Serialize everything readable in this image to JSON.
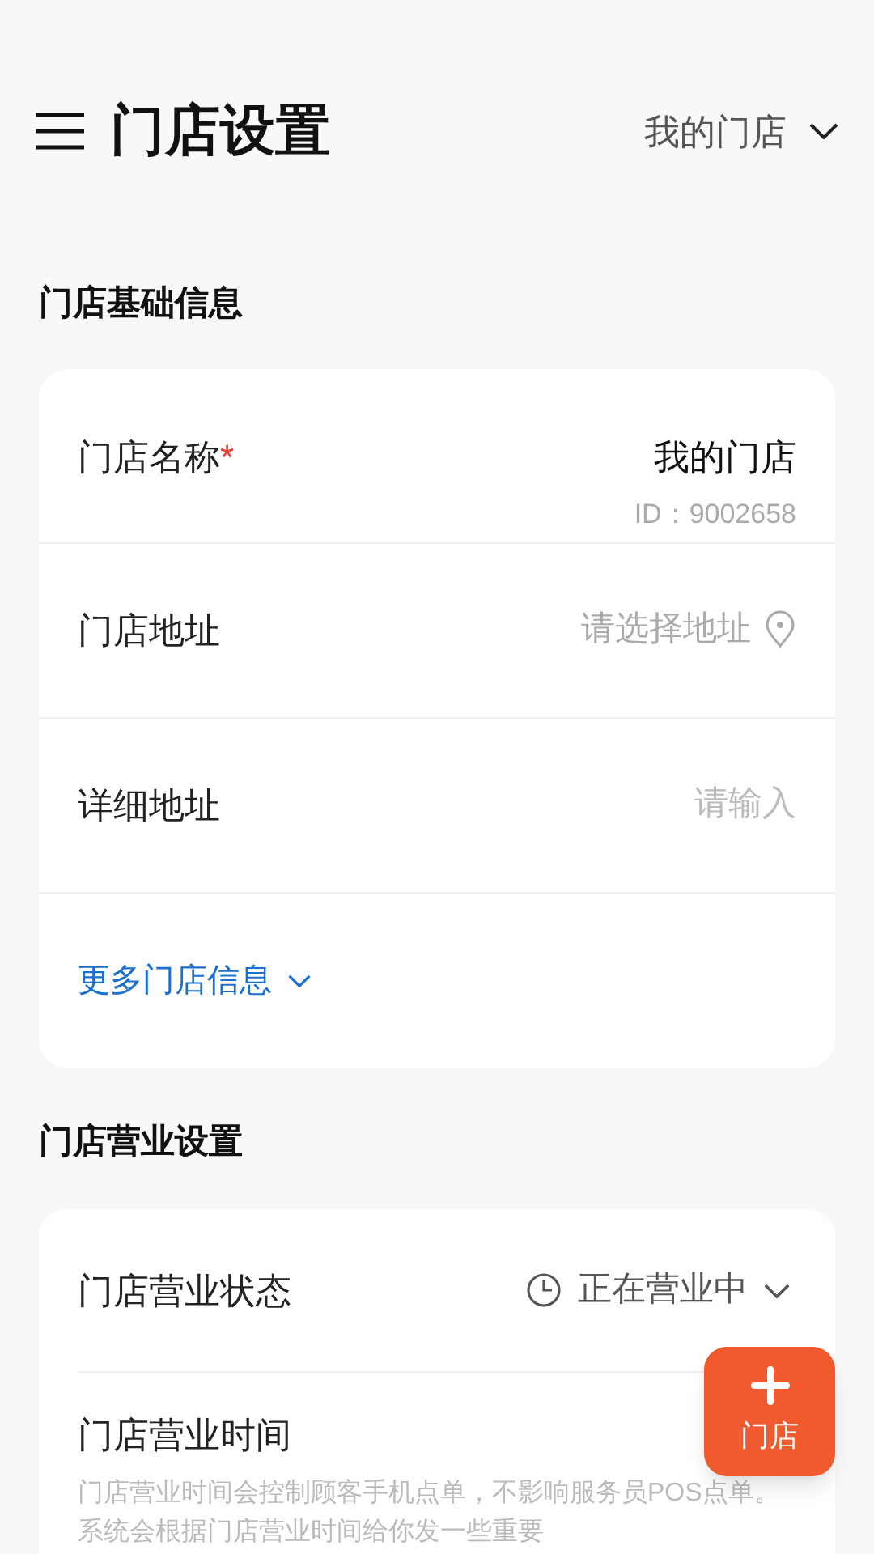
{
  "header": {
    "title": "门店设置",
    "store_selector": "我的门店"
  },
  "basic_section": {
    "title": "门店基础信息",
    "rows": [
      {
        "kind": "value",
        "label": "门店名称",
        "required_mark": "*",
        "value": "我的门店",
        "sub": "ID：9002658"
      },
      {
        "kind": "location",
        "label": "门店地址",
        "placeholder": "请选择地址"
      },
      {
        "kind": "input",
        "label": "详细地址",
        "placeholder": "请输入"
      }
    ],
    "more_link": "更多门店信息"
  },
  "business_section": {
    "title": "门店营业设置",
    "status_row": {
      "label": "门店营业状态",
      "value": "正在营业中"
    },
    "hours_row": {
      "label": "门店营业时间",
      "description": "门店营业时间会控制顾客手机点单，不影响服务员POS点单。系统会根据门店营业时间给你发一些重要"
    }
  },
  "fab": {
    "label": "门店"
  }
}
